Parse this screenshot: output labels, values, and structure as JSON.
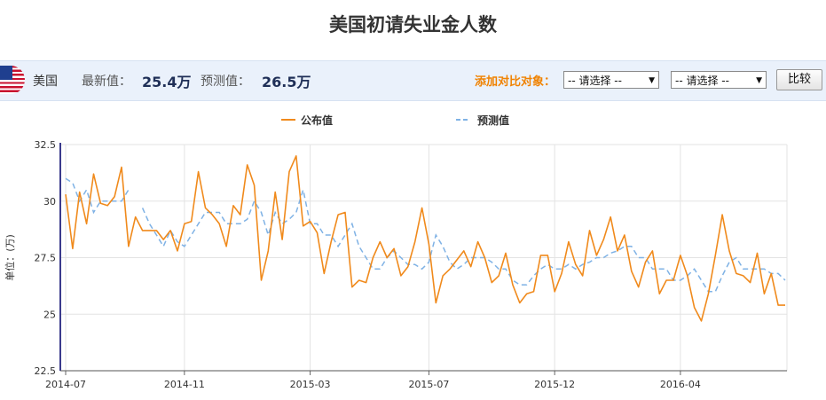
{
  "header": {
    "title": "美国初请失业金人数"
  },
  "infobar": {
    "country": "美国",
    "latest_label": "最新值：",
    "latest_value": "25.4万",
    "forecast_label": "预测值：",
    "forecast_value": "26.5万",
    "compare_label": "添加对比对象：",
    "select1_value": "-- 请选择 --",
    "select2_value": "-- 请选择 --",
    "compare_button": "比较"
  },
  "chart_data": {
    "type": "line",
    "title": "",
    "xlabel": "",
    "ylabel": "单位：(万)",
    "ylim": [
      22.5,
      32.5
    ],
    "yticks": [
      22.5,
      25,
      27.5,
      30,
      32.5
    ],
    "ytick_labels": [
      "22.5",
      "25",
      "27.5",
      "30",
      "32.5"
    ],
    "xtick_labels": [
      "2014-07",
      "2014-11",
      "2015-03",
      "2015-07",
      "2015-12",
      "2016-04"
    ],
    "xtick_index": [
      0,
      17,
      35,
      52,
      70,
      88
    ],
    "legend": {
      "placement": "top-center"
    },
    "colors": {
      "actual": "#f08a1c",
      "forecast": "#7fb2e5",
      "grid": "#e3e3e3",
      "axis": "#3a3a8c"
    },
    "series": [
      {
        "name": "公布值",
        "style": "solid",
        "values": [
          30.3,
          27.9,
          30.4,
          29.0,
          31.2,
          29.9,
          29.8,
          30.2,
          31.5,
          28.0,
          29.3,
          28.7,
          28.7,
          28.7,
          28.3,
          28.7,
          27.8,
          29.0,
          29.1,
          31.3,
          29.7,
          29.4,
          29.0,
          28.0,
          29.8,
          29.4,
          31.6,
          30.7,
          26.5,
          27.8,
          30.4,
          28.3,
          31.3,
          32.0,
          28.9,
          29.1,
          28.6,
          26.8,
          28.2,
          29.4,
          29.5,
          26.2,
          26.5,
          26.4,
          27.5,
          28.2,
          27.5,
          27.9,
          26.7,
          27.1,
          28.2,
          29.7,
          28.1,
          25.5,
          26.7,
          27.0,
          27.4,
          27.8,
          27.1,
          28.2,
          27.5,
          26.4,
          26.7,
          27.7,
          26.3,
          25.5,
          25.9,
          26.0,
          27.6,
          27.6,
          26.0,
          26.8,
          28.2,
          27.2,
          26.7,
          28.7,
          27.6,
          28.3,
          29.3,
          27.8,
          28.5,
          26.9,
          26.2,
          27.3,
          27.8,
          25.9,
          26.5,
          26.5,
          27.6,
          26.7,
          25.3,
          24.7,
          25.9,
          27.6,
          29.4,
          27.8,
          26.8,
          26.7,
          26.4,
          27.7,
          25.9,
          26.8,
          25.4,
          25.4
        ]
      },
      {
        "name": "预测值",
        "style": "dashed",
        "values": [
          31.0,
          30.8,
          30.0,
          30.5,
          29.5,
          30.0,
          30.0,
          30.0,
          30.0,
          30.5,
          null,
          29.7,
          29.0,
          28.5,
          28.0,
          28.7,
          28.2,
          28.0,
          28.5,
          29.0,
          29.5,
          29.5,
          29.5,
          29.0,
          29.0,
          29.0,
          29.2,
          30.0,
          29.5,
          28.5,
          29.5,
          29.0,
          29.2,
          29.5,
          30.5,
          29.0,
          29.0,
          28.5,
          28.5,
          28.0,
          28.5,
          29.0,
          28.0,
          27.5,
          27.0,
          27.0,
          27.5,
          27.8,
          27.5,
          27.2,
          27.2,
          27.0,
          27.3,
          28.5,
          28.0,
          27.3,
          27.0,
          27.2,
          27.5,
          27.5,
          27.5,
          27.3,
          27.0,
          27.0,
          26.5,
          26.3,
          26.3,
          26.7,
          27.0,
          27.2,
          27.0,
          27.0,
          27.2,
          27.0,
          27.2,
          27.3,
          27.5,
          27.5,
          27.7,
          27.8,
          28.0,
          28.0,
          27.5,
          27.5,
          27.0,
          27.0,
          27.0,
          26.5,
          26.5,
          26.7,
          27.0,
          26.5,
          26.0,
          26.0,
          26.7,
          27.3,
          27.5,
          27.0,
          27.0,
          27.0,
          27.0,
          26.8,
          26.8,
          26.5
        ]
      }
    ]
  }
}
